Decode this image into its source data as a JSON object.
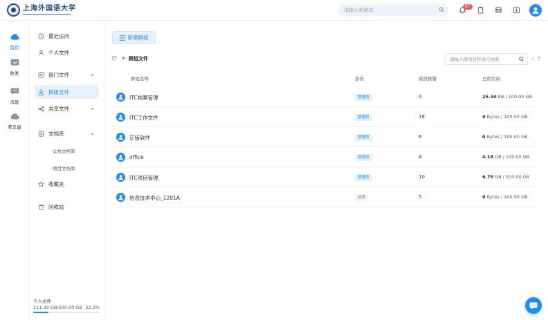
{
  "brand": {
    "name": "上海外国语大学"
  },
  "topbar": {
    "search_placeholder": "请输入关键词",
    "notification_count": "87"
  },
  "rail": [
    {
      "label": "首页",
      "active": true
    },
    {
      "label": "收发",
      "active": false
    },
    {
      "label": "消息",
      "active": false
    },
    {
      "label": "老云盘",
      "active": false
    }
  ],
  "nav": {
    "items": [
      {
        "label": "最近访问"
      },
      {
        "label": "个人文件"
      },
      {
        "label": "部门文件"
      },
      {
        "label": "群组文件"
      },
      {
        "label": "共享文件"
      },
      {
        "label": "文档库"
      },
      {
        "label": "收藏夹"
      },
      {
        "label": "回收站"
      }
    ],
    "sub_items": [
      {
        "label": "公共文档库"
      },
      {
        "label": "项目文档库"
      }
    ],
    "quota": {
      "title": "个人文件",
      "value": "111.39 GB/500.00 GB",
      "percent_label": "22.3%",
      "fraction": 0.223
    }
  },
  "main": {
    "new_group_label": "新建群组",
    "breadcrumb": "群组文件",
    "group_search_placeholder": "请输入群组名称进行搜索",
    "columns": {
      "name": "群组名称",
      "role": "身份",
      "members": "成员数量",
      "used": "已用空间"
    },
    "rows": [
      {
        "name": "ITC档案管理",
        "role": "管理员",
        "members": "4",
        "used_value": "25.34",
        "used_rest": " KB / 100.00 GB",
        "admin": true
      },
      {
        "name": "ITC工作文件",
        "role": "管理员",
        "members": "18",
        "used_value": "0",
        "used_rest": " Bytes / 100.00 GB",
        "admin": true
      },
      {
        "name": "正版软件",
        "role": "管理员",
        "members": "6",
        "used_value": "0",
        "used_rest": " Bytes / 100.00 GB",
        "admin": true
      },
      {
        "name": "office",
        "role": "管理员",
        "members": "4",
        "used_value": "4.18",
        "used_rest": " GB / 100.00 GB",
        "admin": true
      },
      {
        "name": "ITC项目管理",
        "role": "管理员",
        "members": "10",
        "used_value": "6.75",
        "used_rest": " GB / 500.00 GB",
        "admin": true
      },
      {
        "name": "信息技术中心_1201A",
        "role": "成员",
        "members": "5",
        "used_value": "0",
        "used_rest": " Bytes / 100.00 GB",
        "admin": false
      }
    ]
  },
  "colors": {
    "accent": "#1a8cff",
    "badge": "#f05454",
    "brand": "#1f4a8a"
  }
}
